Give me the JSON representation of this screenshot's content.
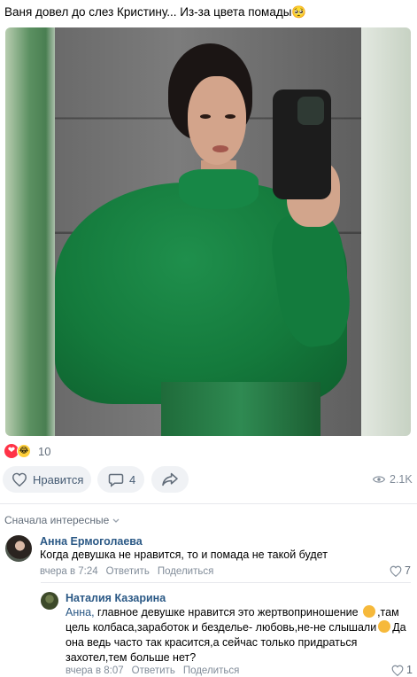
{
  "post": {
    "text": "Ваня довел до слез Кристину... Из-за цвета помады",
    "text_emoji": "🥺"
  },
  "reactions": {
    "heart_icon": "❤",
    "laugh_icon": "😂",
    "count": "10"
  },
  "actions": {
    "like_label": "Нравится",
    "comments_count": "4",
    "views": "2.1K"
  },
  "comments": {
    "sort_label": "Сначала интересные",
    "items": [
      {
        "author": "Анна Ермоголаева",
        "text": "Когда девушка не нравится, то и помада не такой будет",
        "time": "вчера в 7:24",
        "reply": "Ответить",
        "share": "Поделиться",
        "likes": "7"
      },
      {
        "author": "Наталия Казарина",
        "reply_to": "Анна,",
        "text_part1": " главное девушке нравится это жертвоприношение ",
        "text_part2": ",там цель колбаса,заработок и безделье- любовь,не-не слышали",
        "text_part3": "Да она ведь часто так красится,а сейчас только придраться захотел,тем больше нет?",
        "time": "вчера в 8:07",
        "reply": "Ответить",
        "share": "Поделиться",
        "likes": "1"
      }
    ]
  },
  "colors": {
    "link": "#2a5885",
    "muted": "#818c99",
    "pill_bg": "#f0f2f5"
  }
}
